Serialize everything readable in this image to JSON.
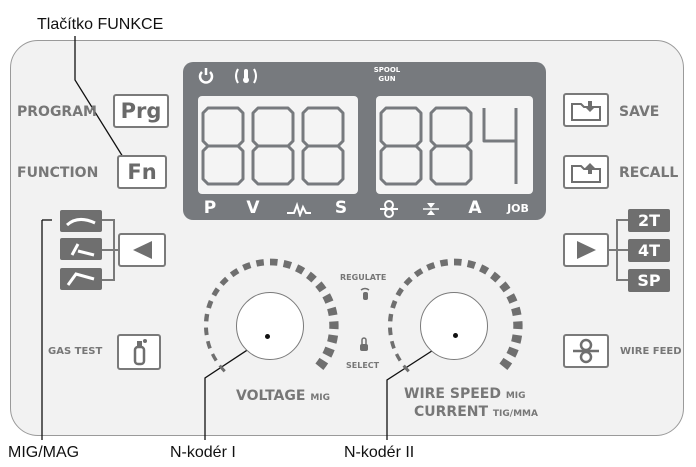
{
  "callouts": {
    "function_button": "Tlačítko FUNKCE",
    "mig_mag": "MIG/MAG",
    "encoder_1": "N-kodér I",
    "encoder_2": "N-kodér II"
  },
  "left_buttons": {
    "program_label": "PROGRAM",
    "program_key": "Prg",
    "function_label": "FUNCTION",
    "function_key": "Fn",
    "gas_test_label": "GAS TEST"
  },
  "right_buttons": {
    "save_label": "SAVE",
    "recall_label": "RECALL",
    "wire_feed_label": "WIRE FEED",
    "modes": [
      "2T",
      "4T",
      "SP"
    ]
  },
  "display": {
    "spool_gun": "SPOOL GUN",
    "left_indicators": [
      "P",
      "V",
      "S"
    ],
    "right_indicators": [
      "A",
      "JOB"
    ]
  },
  "knobs": {
    "regulate": "REGULATE",
    "select": "SELECT",
    "voltage_label": "VOLTAGE",
    "voltage_suffix": "MIG",
    "wire_speed_label": "WIRE SPEED",
    "wire_speed_suffix": "MIG",
    "current_label": "CURRENT",
    "current_suffix": "TIG/MMA"
  },
  "colors": {
    "display_bg": "#777a7e",
    "segment_outline": "#777a7e",
    "dark_button": "#6f6f6f",
    "panel_bg": "#f2f2f2"
  },
  "icons": [
    "power-icon",
    "thermal-warning-icon",
    "mig-torch-icon",
    "tig-torch-icon",
    "mma-electrode-icon",
    "left-arrow-icon",
    "right-arrow-icon",
    "gas-cylinder-icon",
    "save-folder-icon",
    "recall-folder-icon",
    "wire-feed-icon",
    "regulate-hand-icon",
    "select-hand-icon"
  ]
}
